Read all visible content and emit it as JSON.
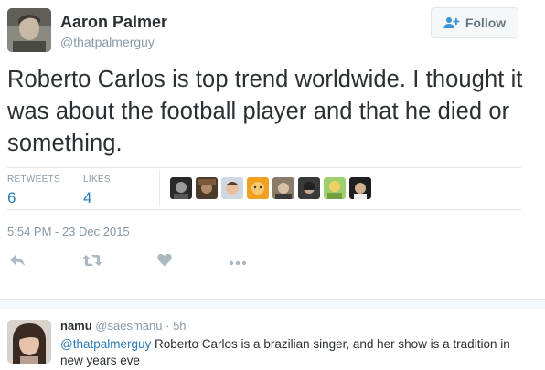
{
  "tweet": {
    "author": {
      "display_name": "Aaron Palmer",
      "handle": "@thatpalmerguy"
    },
    "follow_label": "Follow",
    "text": "Roberto Carlos is top trend worldwide. I thought it was about the football player and that he died or something.",
    "retweets": {
      "label": "RETWEETS",
      "count": "6"
    },
    "likes": {
      "label": "LIKES",
      "count": "4"
    },
    "timestamp": "5:54 PM - 23 Dec 2015",
    "actions": [
      "reply-icon",
      "retweet-icon",
      "like-icon",
      "more-icon"
    ]
  },
  "reply": {
    "name": "namu",
    "handle": "@saesmanu",
    "time": "5h",
    "separator": "·",
    "mention": "@thatpalmerguy",
    "text": " Roberto Carlos is a brazilian singer, and her show is a tradition in new years eve"
  },
  "colors": {
    "link": "#2b7bb9",
    "muted": "#8899a6",
    "text": "#292f33",
    "border": "#e1e8ed"
  }
}
